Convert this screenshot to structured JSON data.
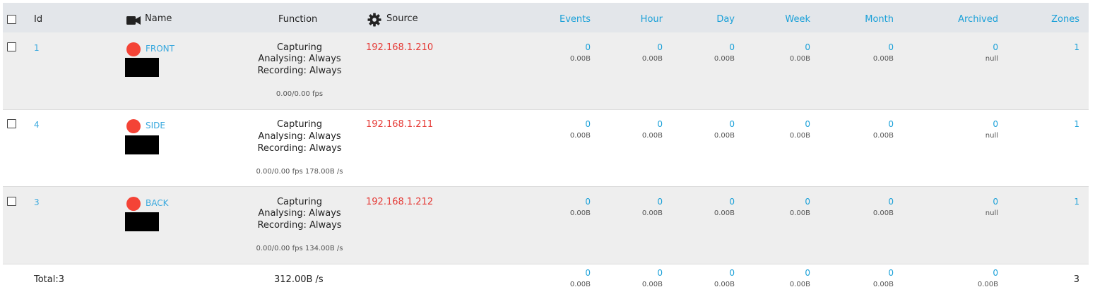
{
  "header": {
    "id": "Id",
    "name": "Name",
    "function": "Function",
    "source": "Source",
    "events": "Events",
    "hour": "Hour",
    "day": "Day",
    "week": "Week",
    "month": "Month",
    "archived": "Archived",
    "zones": "Zones",
    "name_icon": "video-camera-icon",
    "source_icon": "gear-icon"
  },
  "monitors": [
    {
      "id": "1",
      "name": "FRONT",
      "func1": "Capturing",
      "func2": "Analysing: Always",
      "func3": "Recording: Always",
      "fps": "0.00/0.00 fps",
      "source": "192.168.1.210",
      "events": "0",
      "events_size": "0.00B",
      "hour": "0",
      "hour_size": "0.00B",
      "day": "0",
      "day_size": "0.00B",
      "week": "0",
      "week_size": "0.00B",
      "month": "0",
      "month_size": "0.00B",
      "archived": "0",
      "archived_size": "null",
      "zones": "1"
    },
    {
      "id": "4",
      "name": "SIDE",
      "func1": "Capturing",
      "func2": "Analysing: Always",
      "func3": "Recording: Always",
      "fps": "0.00/0.00 fps 178.00B /s",
      "source": "192.168.1.211",
      "events": "0",
      "events_size": "0.00B",
      "hour": "0",
      "hour_size": "0.00B",
      "day": "0",
      "day_size": "0.00B",
      "week": "0",
      "week_size": "0.00B",
      "month": "0",
      "month_size": "0.00B",
      "archived": "0",
      "archived_size": "null",
      "zones": "1"
    },
    {
      "id": "3",
      "name": "BACK",
      "func1": "Capturing",
      "func2": "Analysing: Always",
      "func3": "Recording: Always",
      "fps": "0.00/0.00 fps 134.00B /s",
      "source": "192.168.1.212",
      "events": "0",
      "events_size": "0.00B",
      "hour": "0",
      "hour_size": "0.00B",
      "day": "0",
      "day_size": "0.00B",
      "week": "0",
      "week_size": "0.00B",
      "month": "0",
      "month_size": "0.00B",
      "archived": "0",
      "archived_size": "null",
      "zones": "1"
    }
  ],
  "totals": {
    "label": "Total:3",
    "bandwidth": "312.00B /s",
    "events": "0",
    "events_size": "0.00B",
    "hour": "0",
    "hour_size": "0.00B",
    "day": "0",
    "day_size": "0.00B",
    "week": "0",
    "week_size": "0.00B",
    "month": "0",
    "month_size": "0.00B",
    "archived": "0",
    "archived_size": "0.00B",
    "zones": "3"
  },
  "colors": {
    "link": "#3aa9de",
    "source": "#e53935",
    "status_dot": "#f44336",
    "header_bg": "#e3e6ea",
    "row_alt_bg": "#eeeeee"
  }
}
